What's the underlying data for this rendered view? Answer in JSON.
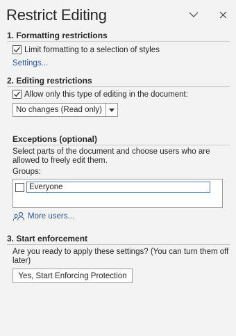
{
  "pane": {
    "title": "Restrict Editing",
    "collapse_icon": "chevron-down-icon",
    "close_icon": "close-icon"
  },
  "formatting": {
    "heading": "1. Formatting restrictions",
    "checkbox_label": "Limit formatting to a selection of styles",
    "checked": true,
    "settings_link": "Settings..."
  },
  "editing": {
    "heading": "2. Editing restrictions",
    "checkbox_label": "Allow only this type of editing in the document:",
    "checked": true,
    "dropdown_value": "No changes (Read only)"
  },
  "exceptions": {
    "heading": "Exceptions (optional)",
    "description_line1": "Select parts of the document and choose users who are",
    "description_line2": "allowed to freely edit them.",
    "groups_label": "Groups:",
    "groups": [
      {
        "name": "Everyone",
        "checked": false
      }
    ],
    "more_users_label": "More users...",
    "more_users_icon": "users-icon"
  },
  "enforcement": {
    "heading": "3. Start enforcement",
    "question_line1": "Are you ready to apply these settings? (You can turn them off",
    "question_line2": "later)",
    "start_button": "Yes, Start Enforcing Protection"
  },
  "colors": {
    "background": "#f3f3f3",
    "link": "#2b5797",
    "text": "#262626"
  }
}
